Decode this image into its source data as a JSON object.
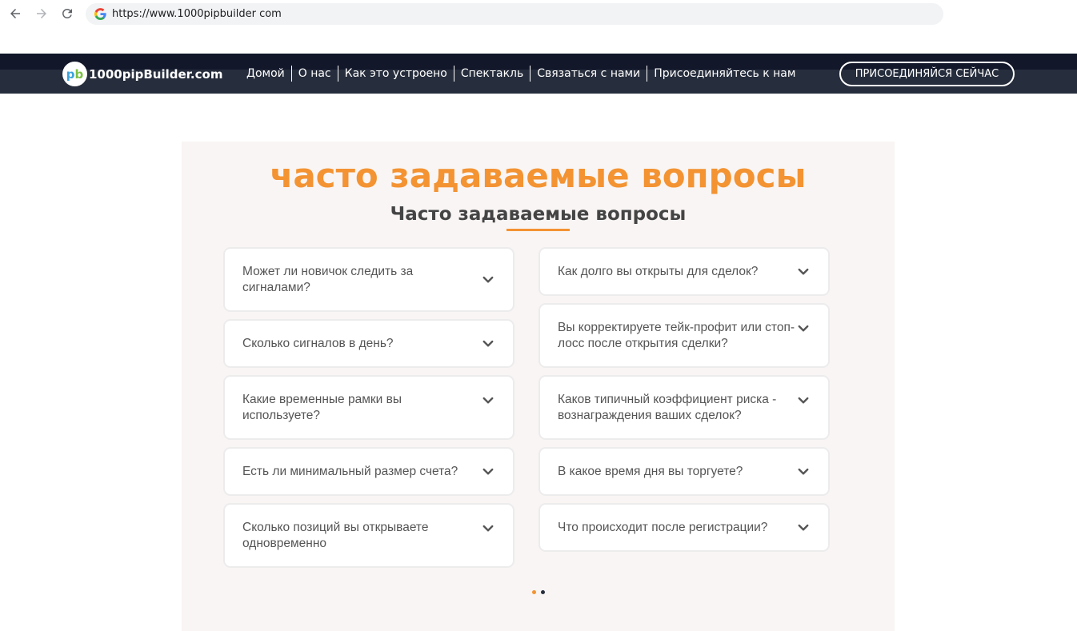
{
  "browser": {
    "url": "https://www.1000pipbuilder com"
  },
  "header": {
    "logo_text": "1000pipBuilder.com",
    "nav": [
      "Домой",
      "О нас",
      "Как это устроено",
      "Спектакль",
      "Связаться с нами",
      "Присоединяйтесь к нам"
    ],
    "join_label": "ПРИСОЕДИНЯЙСЯ СЕЙЧАС"
  },
  "faq": {
    "title": "часто задаваемые вопросы",
    "subtitle": "Часто задаваемые вопросы",
    "left": [
      "Может ли новичок следить за сигналами?",
      "Сколько сигналов в день?",
      "Какие временные рамки вы используете?",
      "Есть ли минимальный размер счета?",
      "Сколько позиций вы открываете одновременно"
    ],
    "right": [
      "Как долго вы открыты для сделок?",
      "Вы корректируете тейк-профит или стоп-лосс после открытия сделки?",
      "Каков типичный коэффициент риска - вознаграждения ваших сделок?",
      "В какое время дня вы торгуете?",
      "Что происходит после регистрации?"
    ]
  },
  "pagination": {
    "active_color": "#f39332",
    "inactive_color": "#262d3c"
  },
  "colors": {
    "accent": "#f39332",
    "header_bg": "#262d3c"
  }
}
